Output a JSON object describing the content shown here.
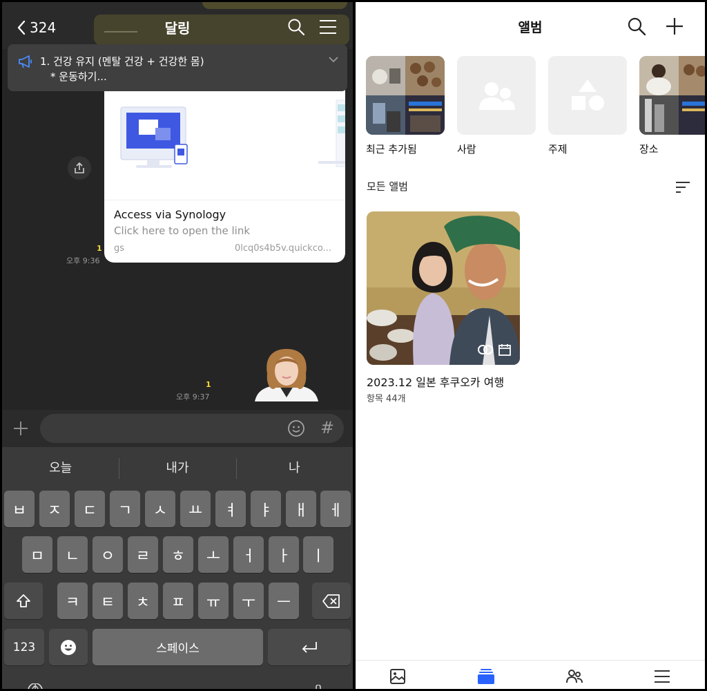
{
  "chat": {
    "back_count": "324",
    "title": "달링",
    "notice": {
      "line1": "1. 건강 유지 (멘탈 건강 + 건강한 몸)",
      "line2": "* 운동하기..."
    },
    "link_card": {
      "title": "Access via Synology",
      "description": "Click here to open the link",
      "gs": "gs",
      "url": "0lcq0s4b5v.quickco..."
    },
    "messages": [
      {
        "unread": "1",
        "time": "오후 9:36"
      },
      {
        "unread": "1",
        "time": "오후 9:37"
      }
    ],
    "input": {
      "value": "",
      "hash": "#"
    }
  },
  "keyboard": {
    "suggestions": [
      "오늘",
      "내가",
      "나"
    ],
    "row1": [
      "ㅂ",
      "ㅈ",
      "ㄷ",
      "ㄱ",
      "ㅅ",
      "ㅛ",
      "ㅕ",
      "ㅑ",
      "ㅐ",
      "ㅔ"
    ],
    "row2": [
      "ㅁ",
      "ㄴ",
      "ㅇ",
      "ㄹ",
      "ㅎ",
      "ㅗ",
      "ㅓ",
      "ㅏ",
      "ㅣ"
    ],
    "row3": [
      "ㅋ",
      "ㅌ",
      "ㅊ",
      "ㅍ",
      "ㅠ",
      "ㅜ",
      "ㅡ"
    ],
    "numbers_label": "123",
    "space_label": "스페이스"
  },
  "photos": {
    "title": "앨범",
    "categories": [
      {
        "label": "최근 추가됨"
      },
      {
        "label": "사람"
      },
      {
        "label": "주제"
      },
      {
        "label": "장소"
      }
    ],
    "section_title": "모든 앨범",
    "albums": [
      {
        "name": "2023.12 일본 후쿠오카 여행",
        "count": "항목 44개"
      }
    ],
    "tabs": [
      "photos-tab",
      "albums-tab",
      "people-tab",
      "menu-tab"
    ],
    "accent_color": "#2962ff"
  }
}
